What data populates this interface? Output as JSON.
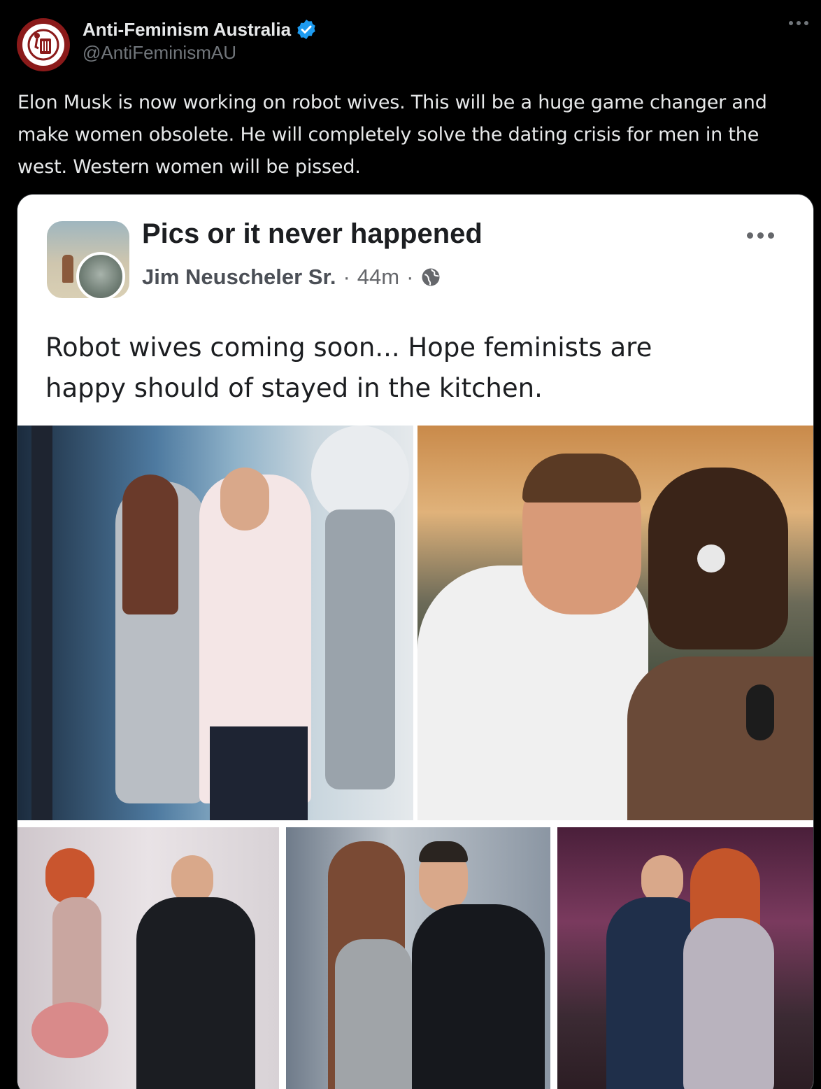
{
  "author": {
    "display_name": "Anti-Feminism Australia",
    "handle": "@AntiFeminismAU"
  },
  "tweet": {
    "text": "Elon Musk is now working on robot wives. This will be a huge game changer and\nmake women obsolete. He will completely solve the dating crisis for men in the\nwest. Western women will be pissed."
  },
  "embedded": {
    "group_name": "Pics or it never happened",
    "poster": "Jim Neuscheler Sr.",
    "time": "44m",
    "separator": "·",
    "text": "Robot wives coming soon... Hope feminists are\nhappy should of stayed in the kitchen."
  },
  "icons": {
    "avatar": "trash-person-icon",
    "verified": "verified-badge-icon",
    "more": "more-options-icon",
    "globe": "globe-icon"
  },
  "colors": {
    "background": "#000000",
    "text": "#e7e9ea",
    "secondary": "#71767b",
    "verified": "#1d9bf0",
    "avatar_ring": "#8b1a1a"
  }
}
